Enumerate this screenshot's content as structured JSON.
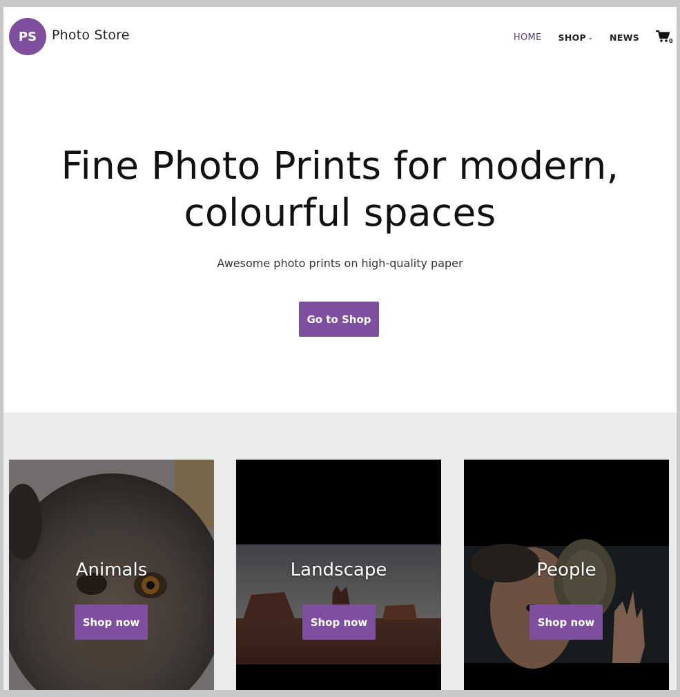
{
  "colors": {
    "accent": "#7e4f9f",
    "background": "#ffffff",
    "section_bg": "#ebebeb"
  },
  "header": {
    "logo_initials": "PS",
    "site_title": "Photo Store",
    "nav": [
      {
        "label": "HOME",
        "active": true
      },
      {
        "label": "SHOP",
        "has_dropdown": true
      },
      {
        "label": "NEWS"
      }
    ],
    "cart": {
      "icon": "cart-icon",
      "count": "0"
    }
  },
  "hero": {
    "title_line1": "Fine Photo Prints for modern,",
    "title_line2": "colourful spaces",
    "subtitle": "Awesome photo prints on high-quality paper",
    "button_label": "Go to Shop"
  },
  "categories": [
    {
      "label": "Animals",
      "button_label": "Shop now"
    },
    {
      "label": "Landscape",
      "button_label": "Shop now"
    },
    {
      "label": "People",
      "button_label": "Shop now"
    }
  ]
}
